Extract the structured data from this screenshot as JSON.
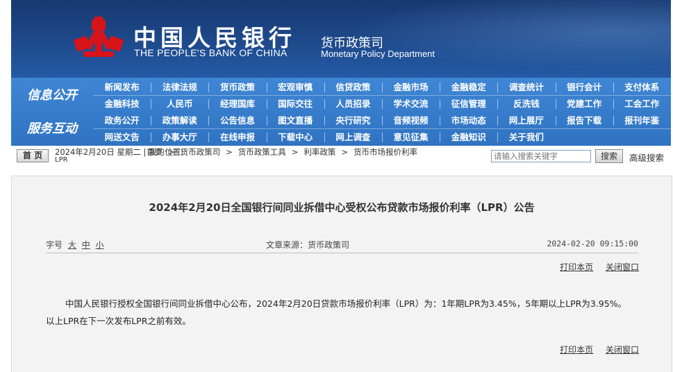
{
  "header": {
    "bank_name_cn": "中国人民银行",
    "bank_name_en": "THE PEOPLE'S BANK OF CHINA",
    "department_cn": "货币政策司",
    "department_en": "Monetary Policy Department",
    "logo_icon": "pboc-emblem-icon",
    "colors": {
      "banner": "#1e4a8c",
      "logo": "#d7141a",
      "nav": "#3a80cf"
    }
  },
  "nav": {
    "info_title": "信息公开",
    "info_row1": [
      "新闻发布",
      "法律法规",
      "货币政策",
      "宏观审慎",
      "信贷政策",
      "金融市场",
      "金融稳定",
      "调查统计",
      "银行会计",
      "支付体系"
    ],
    "info_row2": [
      "金融科技",
      "人民币",
      "经理国库",
      "国际交往",
      "人员招录",
      "学术交流",
      "征信管理",
      "反洗钱",
      "党建工作",
      "工会工作"
    ],
    "service_title": "服务互动",
    "service_row1": [
      "政务公开",
      "政策解读",
      "公告信息",
      "图文直播",
      "央行研究",
      "音频视频",
      "市场动态",
      "网上展厅",
      "报告下载",
      "报刊年鉴"
    ],
    "service_row2": [
      "网送文告",
      "办事大厅",
      "在线申报",
      "下载中心",
      "网上调查",
      "意见征集",
      "金融知识",
      "关于我们"
    ]
  },
  "crumbbar": {
    "home_label": "首 页",
    "date_text": "2024年2月20日 星期二",
    "date_wrap": "LPR",
    "location_prefix": "我的位置:",
    "crumbs": [
      "首页",
      "货币政策司",
      "货币政策工具",
      "利率政策",
      "货币市场报价利率"
    ],
    "search_placeholder": "请输入搜索关键字",
    "search_button": "搜索",
    "advanced_search": "高级搜索"
  },
  "article": {
    "title": "2024年2月20日全国银行间同业拆借中心受权公布贷款市场报价利率（LPR）公告",
    "font_size_label": "字号",
    "font_sizes": [
      "大",
      "中",
      "小"
    ],
    "source": "文章来源：货币政策司",
    "publish_time": "2024-02-20  09:15:00",
    "print_label": "打印本页",
    "close_label": "关闭窗口",
    "body": "中国人民银行授权全国银行间同业拆借中心公布，2024年2月20日贷款市场报价利率（LPR）为：1年期LPR为3.45%，5年期以上LPR为3.95%。以上LPR在下一次发布LPR之前有效。"
  }
}
